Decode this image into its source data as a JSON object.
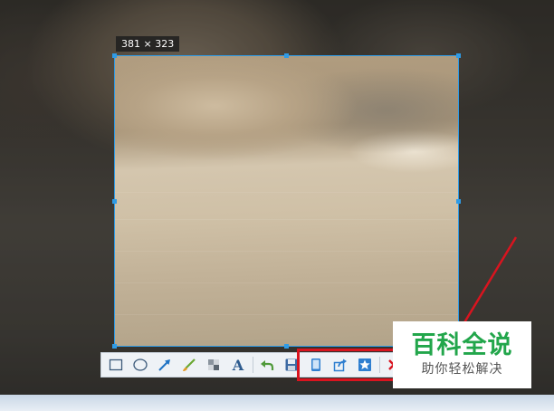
{
  "screenshot_tool": {
    "selection_size_label": "381 × 323",
    "tools": [
      {
        "name": "rectangle-tool",
        "icon": "rectangle-icon"
      },
      {
        "name": "ellipse-tool",
        "icon": "ellipse-icon"
      },
      {
        "name": "arrow-tool",
        "icon": "arrow-icon"
      },
      {
        "name": "brush-tool",
        "icon": "brush-icon"
      },
      {
        "name": "mosaic-tool",
        "icon": "mosaic-icon"
      },
      {
        "name": "text-tool",
        "icon": "text-icon",
        "glyph": "A"
      },
      {
        "name": "undo-tool",
        "icon": "undo-icon"
      },
      {
        "name": "save-tool",
        "icon": "save-icon"
      },
      {
        "name": "phone-tool",
        "icon": "phone-icon"
      },
      {
        "name": "share-tool",
        "icon": "share-icon"
      },
      {
        "name": "favorite-tool",
        "icon": "star-icon"
      },
      {
        "name": "cancel-tool",
        "icon": "close-icon"
      }
    ],
    "colors": {
      "selection_border": "#2f9be6",
      "highlight": "#d9141f",
      "watermark_green": "#22a64b"
    }
  },
  "watermark": {
    "title": "百科全说",
    "subtitle": "助你轻松解决"
  }
}
